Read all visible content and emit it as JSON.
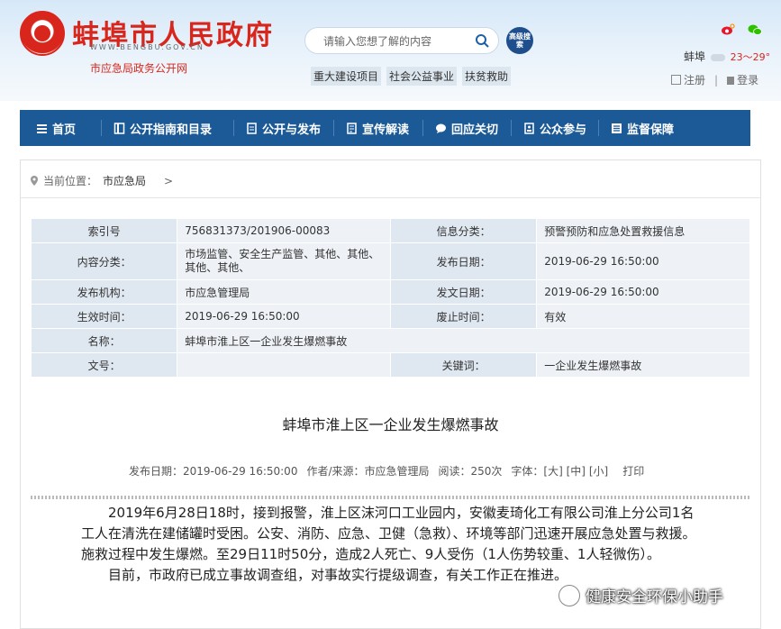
{
  "header": {
    "site_title": "蚌埠市人民政府",
    "site_url": "WWW.BENGBU.GOV.CN",
    "subtitle": "市应急局政务公开网",
    "search_placeholder": "请输入您想了解的内容",
    "adv_search_label": "高级搜索",
    "hotwords": [
      "重大建设项目",
      "社会公益事业",
      "扶贫救助"
    ],
    "weather_city": "蚌埠",
    "weather_temp": "23～29°",
    "register_label": "注册",
    "login_label": "登录",
    "separator": "|"
  },
  "nav": {
    "items": [
      {
        "label": "首页",
        "icon": "home-icon"
      },
      {
        "label": "公开指南和目录",
        "icon": "book-icon"
      },
      {
        "label": "公开与发布",
        "icon": "doc-icon"
      },
      {
        "label": "宣传解读",
        "icon": "file-icon"
      },
      {
        "label": "回应关切",
        "icon": "chat-icon"
      },
      {
        "label": "公众参与",
        "icon": "people-icon"
      },
      {
        "label": "监督保障",
        "icon": "list-icon"
      }
    ]
  },
  "breadcrumb": {
    "prefix": "当前位置：",
    "current": "市应急局",
    "arrow": ">"
  },
  "info_table": {
    "rows": [
      [
        "索引号",
        "756831373/201906-00083",
        "信息分类：",
        "预警预防和应急处置救援信息"
      ],
      [
        "内容分类：",
        "市场监管、安全生产监管、其他、其他、其他、其他、",
        "发布日期：",
        "2019-06-29 16:50:00"
      ],
      [
        "发布机构：",
        "市应急管理局",
        "发文日期：",
        "2019-06-29 16:50:00"
      ],
      [
        "生效时间：",
        "2019-06-29 16:50:00",
        "废止时间：",
        "有效"
      ],
      [
        "名称：",
        "蚌埠市淮上区一企业发生爆燃事故"
      ],
      [
        "文号：",
        "",
        "关键词：",
        "一企业发生爆燃事故"
      ]
    ]
  },
  "article": {
    "title": "蚌埠市淮上区一企业发生爆燃事故",
    "meta_date": "发布日期：2019-06-29 16:50:00",
    "meta_author": "作者/来源：市应急管理局",
    "meta_views": "阅读：250次",
    "meta_font": "字体：",
    "font_large": "[大]",
    "font_mid": "[中]",
    "font_small": "[小]",
    "print": "打印",
    "para1": "2019年6月28日18时，接到报警，淮上区沫河口工业园内，安徽麦琦化工有限公司淮上分公司1名工人在清洗在建储罐时受困。公安、消防、应急、卫健（急救）、环境等部门迅速开展应急处置与救援。施救过程中发生爆燃。至29日11时50分，造成2人死亡、9人受伤（1人伤势较重、1人轻微伤）。",
    "para2": "目前，市政府已成立事故调查组，对事故实行提级调查，有关工作正在推进。"
  },
  "watermark": "健康安全环保小助手"
}
